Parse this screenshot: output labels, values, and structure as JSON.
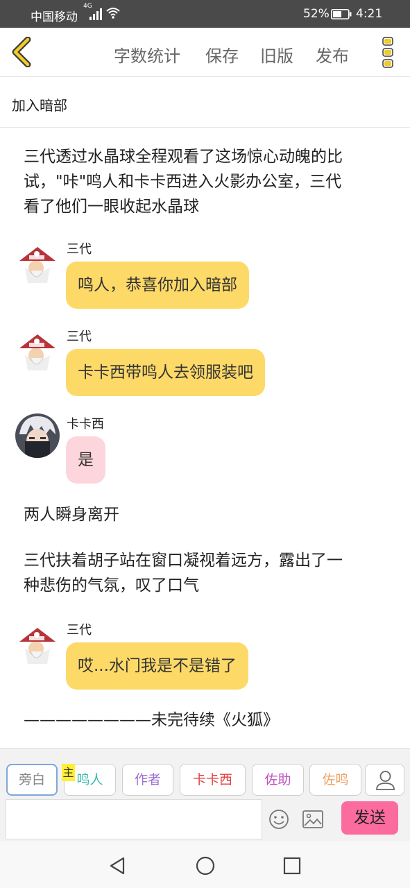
{
  "status_bar": {
    "carrier": "中国移动",
    "network_type": "4G",
    "battery_percent": "52%",
    "time": "4:21",
    "icons": [
      "signal-icon",
      "wifi-icon",
      "battery-icon"
    ]
  },
  "toolbar": {
    "back_icon": "chevron-left-icon",
    "word_count_label": "字数统计",
    "save_label": "保存",
    "old_version_label": "旧版",
    "publish_label": "发布",
    "more_icon": "vertical-dots-icon",
    "accent_color": "#f0cc2a"
  },
  "chapter": {
    "title": "加入暗部"
  },
  "story": {
    "narration_1_line1": "三代透过水晶球全程观看了这场惊心动魄的比",
    "narration_1_line2": "试，\"咔\"鸣人和卡卡西进入火影办公室，三代",
    "narration_1_line3": "看了他们一眼收起水晶球",
    "msg_1_speaker": "三代",
    "msg_1_text": "鸣人，恭喜你加入暗部",
    "msg_2_speaker": "三代",
    "msg_2_text": "卡卡西带鸣人去领服装吧",
    "msg_3_speaker": "卡卡西",
    "msg_3_text": "是",
    "narration_2": "两人瞬身离开",
    "narration_3_line1": "三代扶着胡子站在窗口凝视着远方，露出了一",
    "narration_3_line2": "种悲伤的气氛，叹了口气",
    "msg_4_speaker": "三代",
    "msg_4_text": "哎...水门我是不是错了",
    "narration_4": "————————未完待续《火狐》",
    "bubble_colors": {
      "yellow": "#fdd968",
      "pink": "#fdd5dc"
    }
  },
  "composer": {
    "roles": [
      {
        "label": "旁白",
        "color": "#888888"
      },
      {
        "label": "鸣人",
        "color": "#3cbfae"
      },
      {
        "label": "作者",
        "color": "#a070d0"
      },
      {
        "label": "卡卡西",
        "color": "#e04040"
      },
      {
        "label": "佐助",
        "color": "#c050c0"
      },
      {
        "label": "佐鸣",
        "color": "#f0a060"
      }
    ],
    "main_tag": "主",
    "add_role_icon": "user-icon",
    "input_value": "",
    "emoji_icon": "smiley-icon",
    "image_icon": "image-icon",
    "send_label": "发送",
    "send_color": "#fb6b9e"
  },
  "navbar": {
    "icons": [
      "back-triangle-icon",
      "home-circle-icon",
      "recents-square-icon"
    ]
  }
}
